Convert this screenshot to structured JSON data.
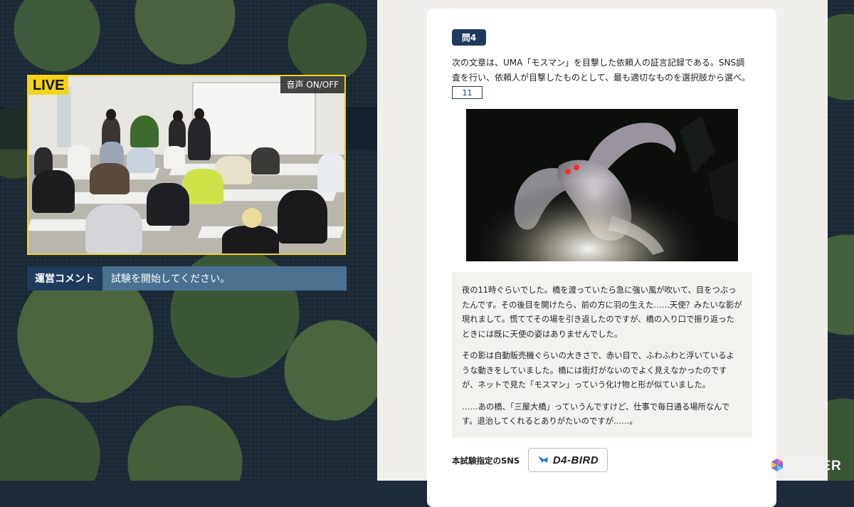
{
  "live": {
    "badge": "LIVE",
    "audio_toggle": "音声 ON/OFF"
  },
  "comment": {
    "label": "運営コメント",
    "text": "試験を開始してください。"
  },
  "question": {
    "number": "問4",
    "text": "次の文章は、UMA「モスマン」を目撃した依頼人の証言記録である。SNS調査を行い、依頼人が目撃したものとして、最も適切なものを選択肢から選べ。",
    "answer_value": "11"
  },
  "testimony": {
    "paragraphs": [
      "夜の11時ぐらいでした。橋を渡っていたら急に強い風が吹いて、目をつぶったんです。その後目を開けたら、前の方に羽の生えた……天使？みたいな影が現れまして。慌ててその場を引き返したのですが、橋の入り口で振り返ったときには既に天使の姿はありませんでした。",
      "その影は自動販売機ぐらいの大きさで、赤い目で、ふわふわと浮いているような動きをしていました。橋には街灯がないのでよく見えなかったのですが、ネットで見た「モスマン」っていう化け物と形が似ていました。",
      "……あの橋、「三屋大橋」っていうんですけど、仕事で毎日通る場所なんです。退治してくれるとありがたいのですが……。"
    ]
  },
  "sns": {
    "label": "本試験指定のSNS",
    "name": "D4-BIRD"
  },
  "watermark": "GAMER",
  "colors": {
    "live_yellow": "#f3d21c",
    "navy": "#1f3a5a",
    "comment_blue": "#4b7090"
  }
}
